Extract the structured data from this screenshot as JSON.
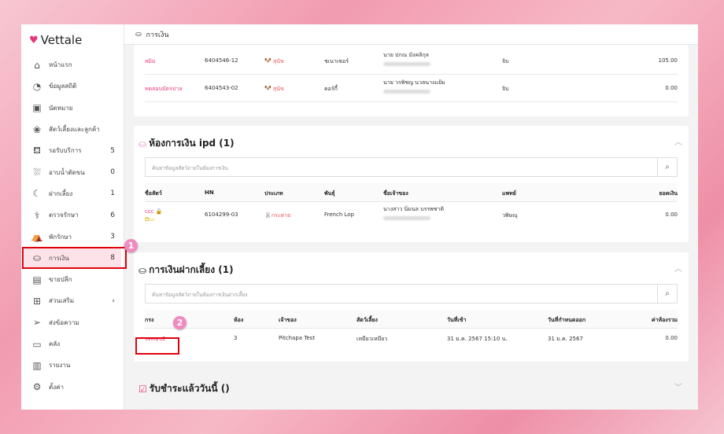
{
  "app": {
    "logo": "Vettale",
    "page_title": "การเงิน"
  },
  "sidebar": {
    "items": [
      {
        "label": "หน้าแรก",
        "icon": "home-icon",
        "count": ""
      },
      {
        "label": "ข้อมูลสถิติ",
        "icon": "dashboard-icon",
        "count": ""
      },
      {
        "label": "นัดหมาย",
        "icon": "calendar-icon",
        "count": ""
      },
      {
        "label": "สัตว์เลี้ยงและลูกค้า",
        "icon": "paw-icon",
        "count": ""
      },
      {
        "label": "รอรับบริการ",
        "icon": "sofa-icon",
        "count": "5"
      },
      {
        "label": "อาบน้ำตัดขน",
        "icon": "bath-icon",
        "count": "0"
      },
      {
        "label": "ฝากเลี้ยง",
        "icon": "moon-icon",
        "count": "1"
      },
      {
        "label": "ตรวจรักษา",
        "icon": "stethoscope-icon",
        "count": "6"
      },
      {
        "label": "พักรักษา",
        "icon": "bed-icon",
        "count": "3"
      },
      {
        "label": "การเงิน",
        "icon": "money-hand-icon",
        "count": "8"
      },
      {
        "label": "ขายปลีก",
        "icon": "cash-register-icon",
        "count": ""
      },
      {
        "label": "ส่วนเสริม",
        "icon": "plus-box-icon",
        "count": "›"
      },
      {
        "label": "ส่งข้อความ",
        "icon": "send-icon",
        "count": ""
      },
      {
        "label": "คลัง",
        "icon": "archive-icon",
        "count": ""
      },
      {
        "label": "รายงาน",
        "icon": "chart-icon",
        "count": ""
      },
      {
        "label": "ตั้งค่า",
        "icon": "gear-icon",
        "count": ""
      }
    ],
    "active_index": 9
  },
  "annotations": {
    "step1": "1",
    "step2": "2"
  },
  "opd": {
    "rows": [
      {
        "name": "สมิม",
        "hn": "6404546-12",
        "type": "สุนัข",
        "breed": "ชเนาเซอร์",
        "owner": "นาย ปกณ มังคลิกุล",
        "vet": "จิบ",
        "amount": "105.00"
      },
      {
        "name": "ทดสอบบัตรปาล",
        "hn": "6404543-02",
        "type": "สุนัข",
        "breed": "คอร์กี้",
        "owner": "นาย วรพิชญ นวลนางแย้ม",
        "vet": "จิบ",
        "amount": "0.00"
      }
    ]
  },
  "ipd": {
    "title": "ห้องการเงิน ipd (1)",
    "search_placeholder": "ค้นหาข้อมูลสัตว์ภายในห้องการเงิน",
    "headers": [
      "ชื่อสัตว์",
      "HN",
      "ประเภท",
      "พันธุ์",
      "ชื่อเจ้าของ",
      "แพทย์",
      "ยอดเงิน"
    ],
    "rows": [
      {
        "name": "ccc",
        "hn": "6104299-03",
        "type": "กระต่าย",
        "breed": "French Lop",
        "owner": "นางสาว นิ่มนล บรรพชาติ",
        "vet": "วพิษณุ",
        "amount": "0.00"
      }
    ]
  },
  "boarding": {
    "title": "การเงินฝากเลี้ยง (1)",
    "search_placeholder": "ค้นหาข้อมูลสัตว์ภายในห้องการเงินฝากเลี้ยง",
    "headers": [
      "กรง",
      "ห้อง",
      "เจ้าของ",
      "สัตว์เลี้ยง",
      "วันที่เข้า",
      "วันที่กำหนดออก",
      "ค่าห้องรวม"
    ],
    "rows": [
      {
        "cage": "ทดสอบ2",
        "room": "3",
        "owner": "Pitchapa Test",
        "pet": "เหมียวเหมียว",
        "check_in": "31 ม.ค. 2567 15:10 น.",
        "check_out": "31 ม.ค. 2567",
        "total": "0.00"
      }
    ]
  },
  "paid_today": {
    "title": "รับชำระแล้ววันนี้ ()"
  }
}
